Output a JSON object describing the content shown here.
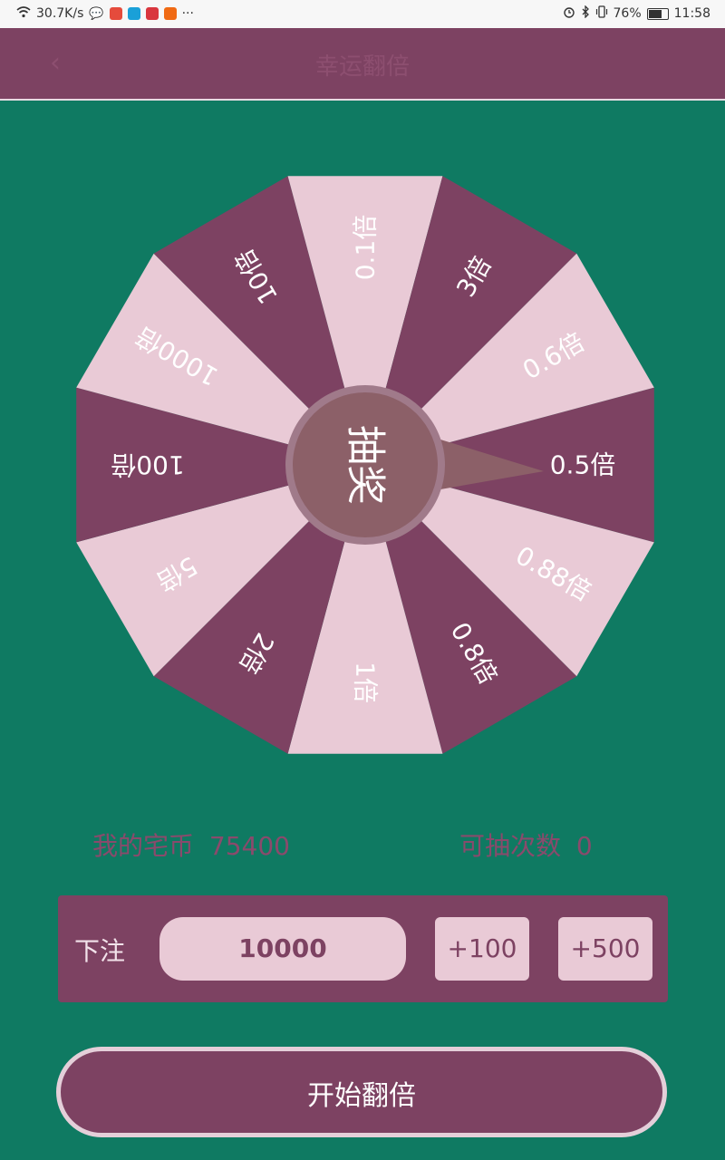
{
  "status_bar": {
    "net_speed": "30.7K/s",
    "battery": "76%",
    "battery_level": 0.76,
    "time": "11:58",
    "more": "···",
    "icons": [
      "wifi-icon",
      "wechat-icon",
      "app-red-icon",
      "app-blue-icon",
      "app-weibo-icon",
      "app-taobao-icon",
      "alarm-icon",
      "bluetooth-icon",
      "vibrate-icon",
      "battery-icon"
    ]
  },
  "app_bar": {
    "title": "幸运翻倍",
    "back_icon": "back-arrow-icon"
  },
  "wheel": {
    "segments": [
      "0.5倍",
      "0.88倍",
      "0.8倍",
      "1倍",
      "2倍",
      "5倍",
      "100倍",
      "1000倍",
      "10倍",
      "0.1倍",
      "3倍",
      "0.6倍"
    ],
    "colors": {
      "dark": "#7d4262",
      "light": "#e9cad6",
      "hub": "#8c6068",
      "hub_ring": "#a07a8a"
    },
    "hub_label": "抽奖"
  },
  "info": {
    "coins_label": "我的宅币",
    "coins_value": "75400",
    "draws_label": "可抽次数",
    "draws_value": "0"
  },
  "bet": {
    "label": "下注",
    "value": "10000",
    "plus100": "+100",
    "plus500": "+500"
  },
  "start_button": "开始翻倍"
}
